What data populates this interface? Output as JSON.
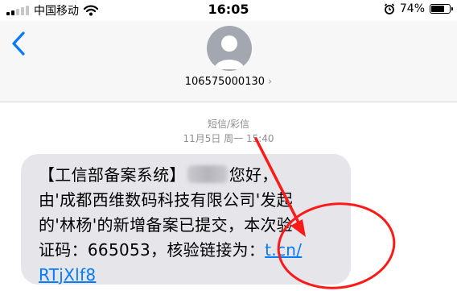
{
  "status_bar": {
    "carrier": "中国移动",
    "time": "16:05",
    "battery_percent_label": "74%",
    "battery_level": 0.74,
    "signal_bars_filled": 2
  },
  "header": {
    "back_icon": "chevron-left-icon",
    "sender_number": "106575000130",
    "sender_chevron": "›"
  },
  "conversation": {
    "message_type": "短信/彩信",
    "timestamp": "11月5日 周一 15:40"
  },
  "message": {
    "line1_prefix": "【工信部备案系统】",
    "line1_suffix": "您好，",
    "line2": "由'成都西维数码科技有限公司'发起",
    "line3": "的'林杨'的新增备案已提交，本次验",
    "line4_prefix": "证码：665053，核验链接为：",
    "link_part1": "t.cn/",
    "link_part2": "RTjXlf8"
  },
  "colors": {
    "link": "#007aff",
    "bubble": "#e5e5ea",
    "annotation": "#ff1a1a"
  }
}
